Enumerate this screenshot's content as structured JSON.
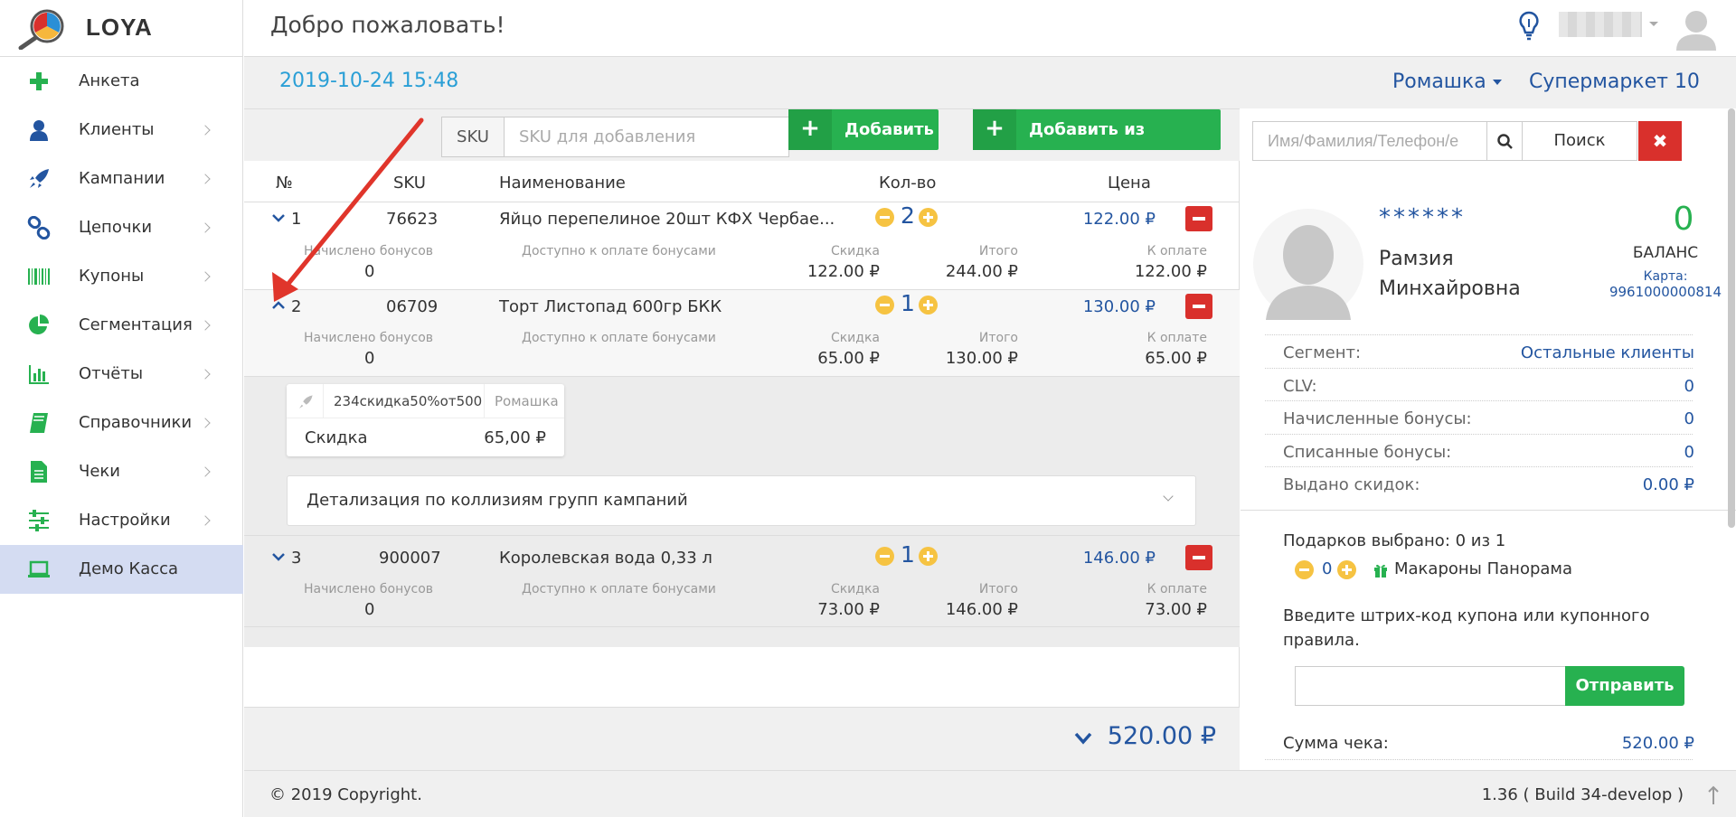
{
  "app": {
    "title": "LOYA"
  },
  "colors": {
    "accent": "#2355a0",
    "green": "#27b150",
    "red": "#d9302c",
    "yellow": "#f6c342",
    "active_nav": "#d4dcf2",
    "arrow": "#e0352b"
  },
  "sidebar": {
    "items": [
      {
        "label": "Анкета",
        "icon": "plus-icon"
      },
      {
        "label": "Клиенты",
        "icon": "user-icon"
      },
      {
        "label": "Кампании",
        "icon": "rocket-icon"
      },
      {
        "label": "Цепочки",
        "icon": "link-icon"
      },
      {
        "label": "Купоны",
        "icon": "barcode-icon"
      },
      {
        "label": "Сегментация",
        "icon": "pie-chart-icon"
      },
      {
        "label": "Отчёты",
        "icon": "bar-chart-icon"
      },
      {
        "label": "Справочники",
        "icon": "book-icon"
      },
      {
        "label": "Чеки",
        "icon": "document-icon"
      },
      {
        "label": "Настройки",
        "icon": "sliders-icon"
      },
      {
        "label": "Демо Касса",
        "icon": "laptop-icon",
        "active": true
      }
    ]
  },
  "header": {
    "welcome": "Добро пожаловать!"
  },
  "subbar": {
    "datetime": "2019-10-24 15:48",
    "store": "Ромашка",
    "market": "Супермаркет 10"
  },
  "toolbar": {
    "sku_label": "SKU",
    "sku_placeholder": "SKU для добавления",
    "add_label": "Добавить",
    "add_catalog_label": "Добавить из каталога"
  },
  "table": {
    "headers": [
      "№",
      "SKU",
      "Наименование",
      "Кол-во",
      "Цена"
    ],
    "sub_labels": {
      "bonus": "Начислено бонусов",
      "avail": "Доступно к оплате бонусами",
      "discount": "Скидка",
      "total": "Итого",
      "topay": "К оплате"
    },
    "rows": [
      {
        "n": "1",
        "sku": "76623",
        "name": "Яйцо перепелиное 20шт КФХ Чербае...",
        "qty": "2",
        "price": "122.00 ₽",
        "bonus": "0",
        "discount": "122.00 ₽",
        "total": "244.00 ₽",
        "topay": "122.00 ₽"
      },
      {
        "n": "2",
        "sku": "06709",
        "name": "Торт Листопад 600гр БКК",
        "qty": "1",
        "price": "130.00 ₽",
        "bonus": "0",
        "discount": "65.00 ₽",
        "total": "130.00 ₽",
        "topay": "65.00 ₽"
      },
      {
        "n": "3",
        "sku": "900007",
        "name": "Королевская вода 0,33 л",
        "qty": "1",
        "price": "146.00 ₽",
        "bonus": "0",
        "discount": "73.00 ₽",
        "total": "146.00 ₽",
        "topay": "73.00 ₽"
      }
    ],
    "detail": {
      "campaign": "234скидка50%от500",
      "store": "Ромашка",
      "label": "Скидка",
      "value": "65,00 ₽",
      "collision": "Детализация по коллизиям групп кампаний"
    },
    "grand_total": "520.00 ₽"
  },
  "customer": {
    "search_placeholder": "Имя/Фамилия/Телефон/е",
    "search_label": "Поиск",
    "masked": "******",
    "first_name": "Рамзия",
    "patronymic": "Минхайровна",
    "balance": "0",
    "balance_label": "БАЛАНС",
    "card_label": "Карта:",
    "card_number": "9961000000814",
    "fields": [
      {
        "label": "Сегмент:",
        "value": "Остальные клиенты"
      },
      {
        "label": "CLV:",
        "value": "0"
      },
      {
        "label": "Начисленные бонусы:",
        "value": "0"
      },
      {
        "label": "Списанные бонусы:",
        "value": "0"
      },
      {
        "label": "Выдано скидок:",
        "value": "0.00 ₽"
      }
    ],
    "gifts_label": "Подарков выбрано: 0 из 1",
    "gift_qty": "0",
    "gift_name": "Макароны Панорама",
    "coupon_prompt": "Введите штрих-код купона или купонного правила.",
    "send_label": "Отправить",
    "sum_label": "Сумма чека:",
    "sum_value": "520.00 ₽"
  },
  "footer": {
    "copyright": "© 2019 Copyright.",
    "version": "1.36 ( Build 34-develop )"
  }
}
